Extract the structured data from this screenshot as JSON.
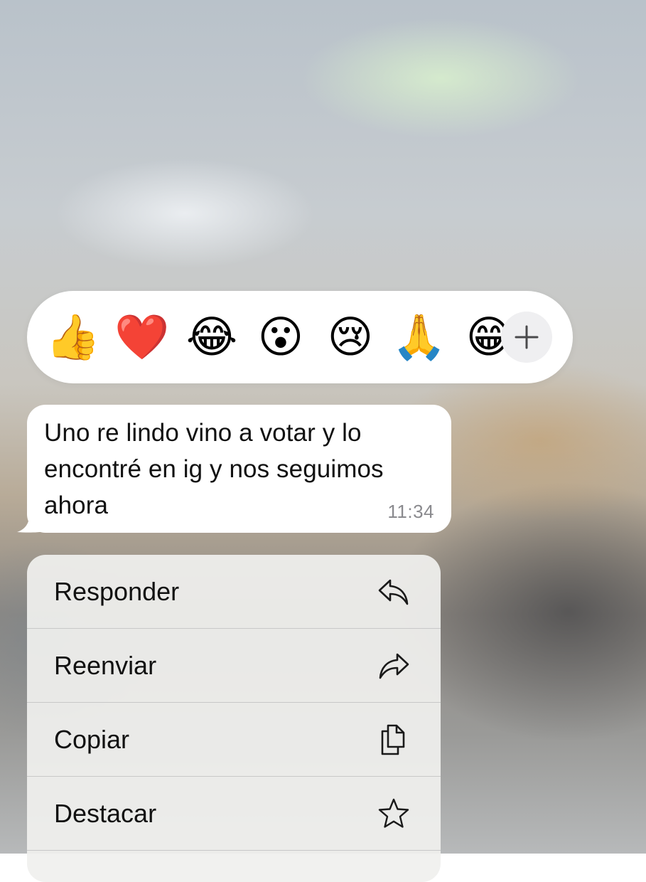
{
  "reactions": {
    "emojis": [
      "👍",
      "❤️",
      "😂",
      "😮",
      "😢",
      "🙏",
      "😁"
    ],
    "more_label": "+"
  },
  "message": {
    "text": "Uno re lindo vino a votar y lo encontré en ig y nos seguimos ahora",
    "lines": [
      "Uno re lindo vino a votar y lo",
      "encontré en ig y nos seguimos",
      "ahora"
    ],
    "time": "11:34"
  },
  "menu": {
    "items": [
      {
        "label": "Responder",
        "icon": "reply-icon"
      },
      {
        "label": "Reenviar",
        "icon": "forward-icon"
      },
      {
        "label": "Copiar",
        "icon": "copy-icon"
      },
      {
        "label": "Destacar",
        "icon": "star-icon"
      }
    ]
  }
}
